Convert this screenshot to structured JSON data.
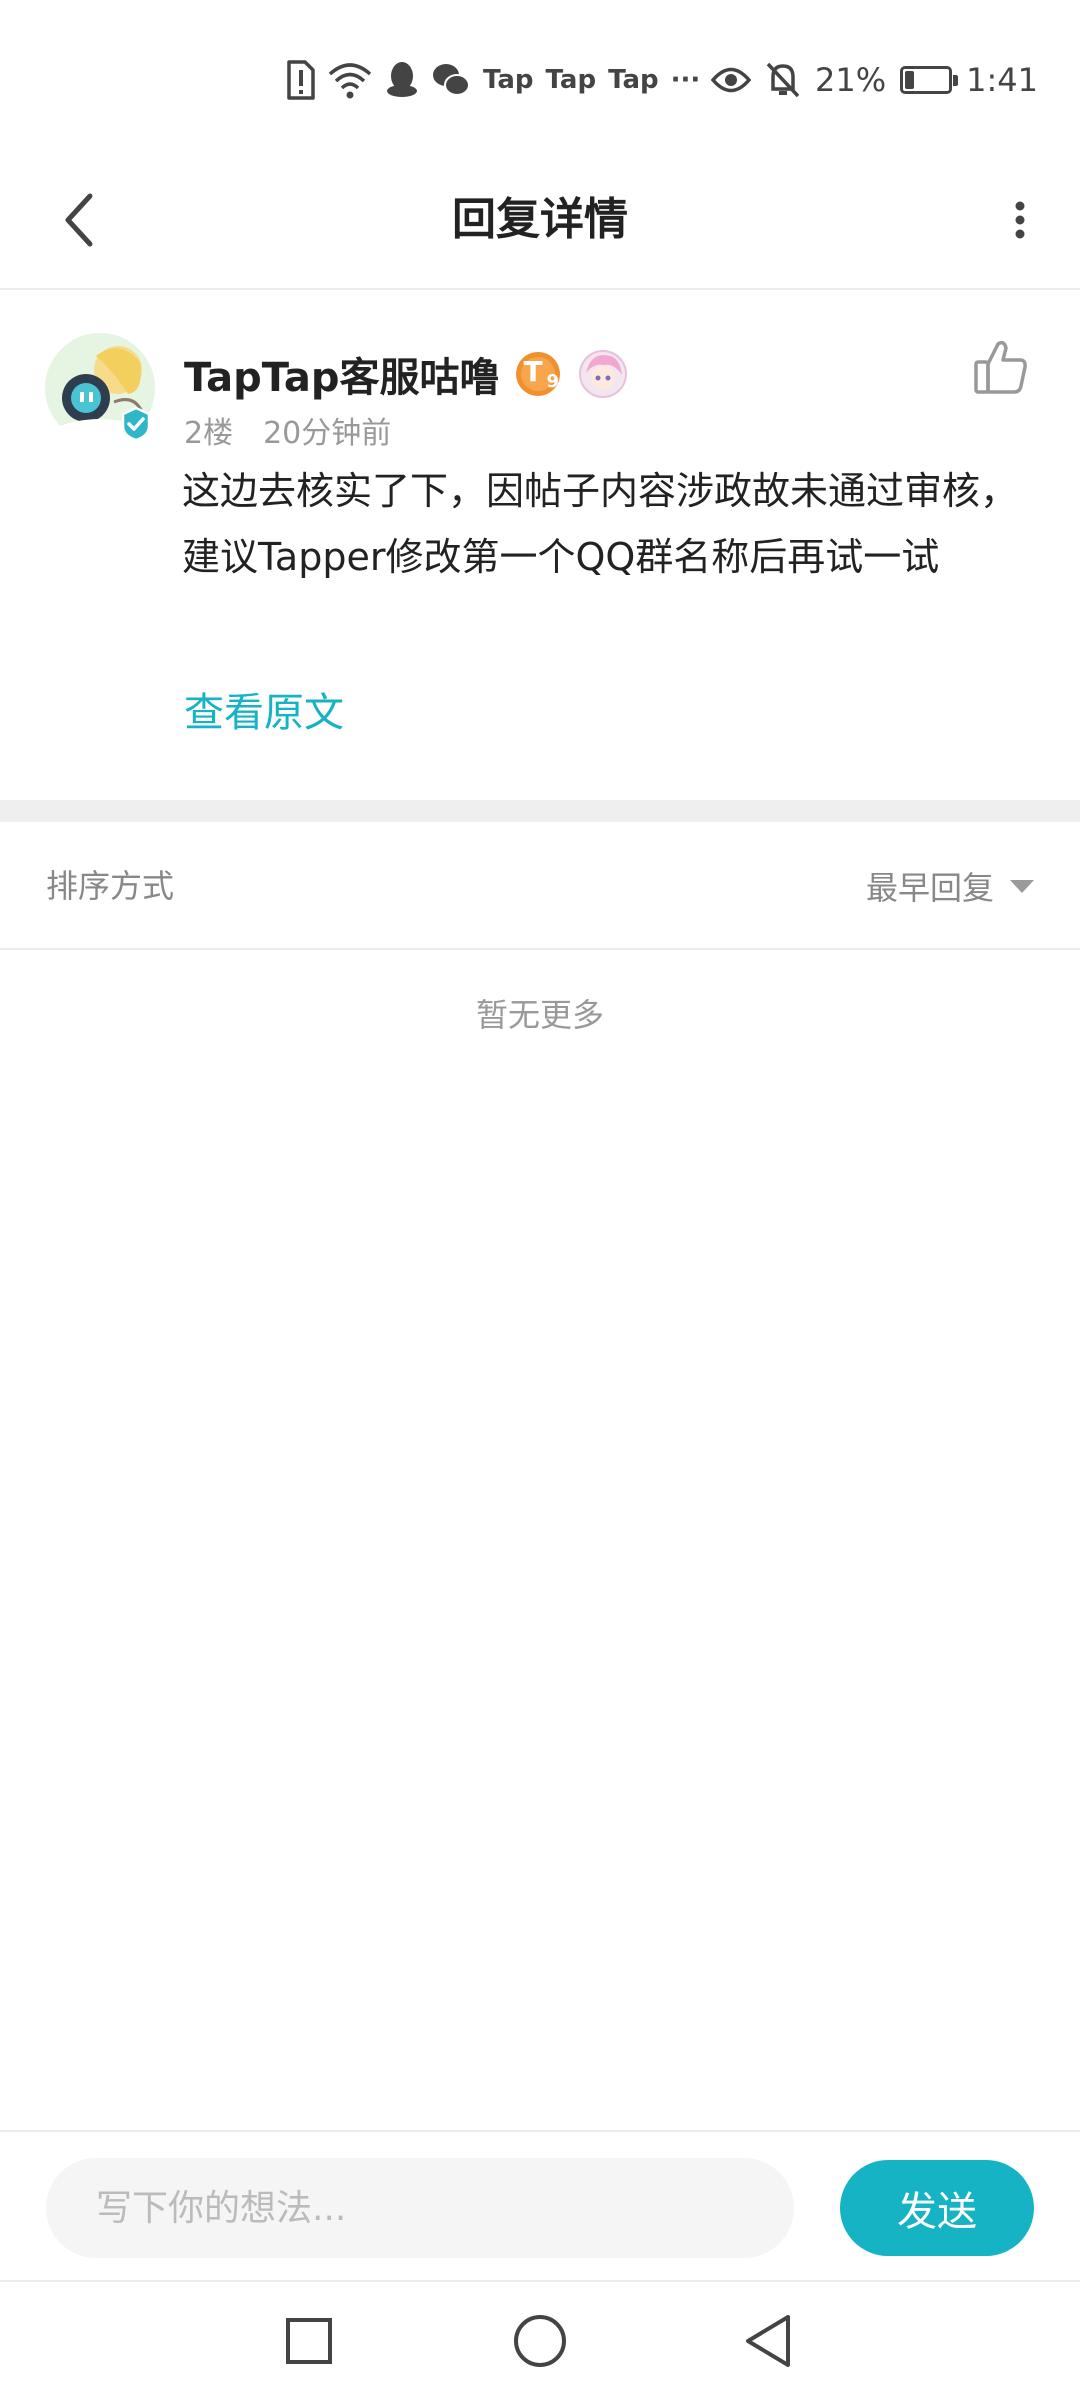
{
  "status_bar": {
    "app_labels": [
      "Tap",
      "Tap",
      "Tap"
    ],
    "more_indicator": "···",
    "battery_percent": "21%",
    "battery_level": 0.21,
    "time": "1:41",
    "icons": [
      "sim-alert-icon",
      "wifi-icon",
      "qq-icon",
      "wechat-icon",
      "eye-icon",
      "bell-off-icon",
      "battery-icon"
    ]
  },
  "header": {
    "title": "回复详情",
    "back_icon": "chevron-left-icon",
    "more_icon": "more-vertical-icon"
  },
  "post": {
    "author": "TapTap客服咕噜",
    "badge_level": "T",
    "badge_number": "9",
    "floor": "2楼",
    "time": "20分钟前",
    "content": "这边去核实了下，因帖子内容涉政故未通过审核，建议Tapper修改第一个QQ群名称后再试一试",
    "view_original": "查看原文",
    "like_icon": "thumbs-up-icon",
    "accent_color": "#15b3c4"
  },
  "sort": {
    "label": "排序方式",
    "value": "最早回复"
  },
  "empty_text": "暂无更多",
  "composer": {
    "placeholder": "写下你的想法...",
    "send_label": "发送"
  },
  "nav": {
    "icons": [
      "recents-square-icon",
      "home-circle-icon",
      "back-triangle-icon"
    ]
  }
}
